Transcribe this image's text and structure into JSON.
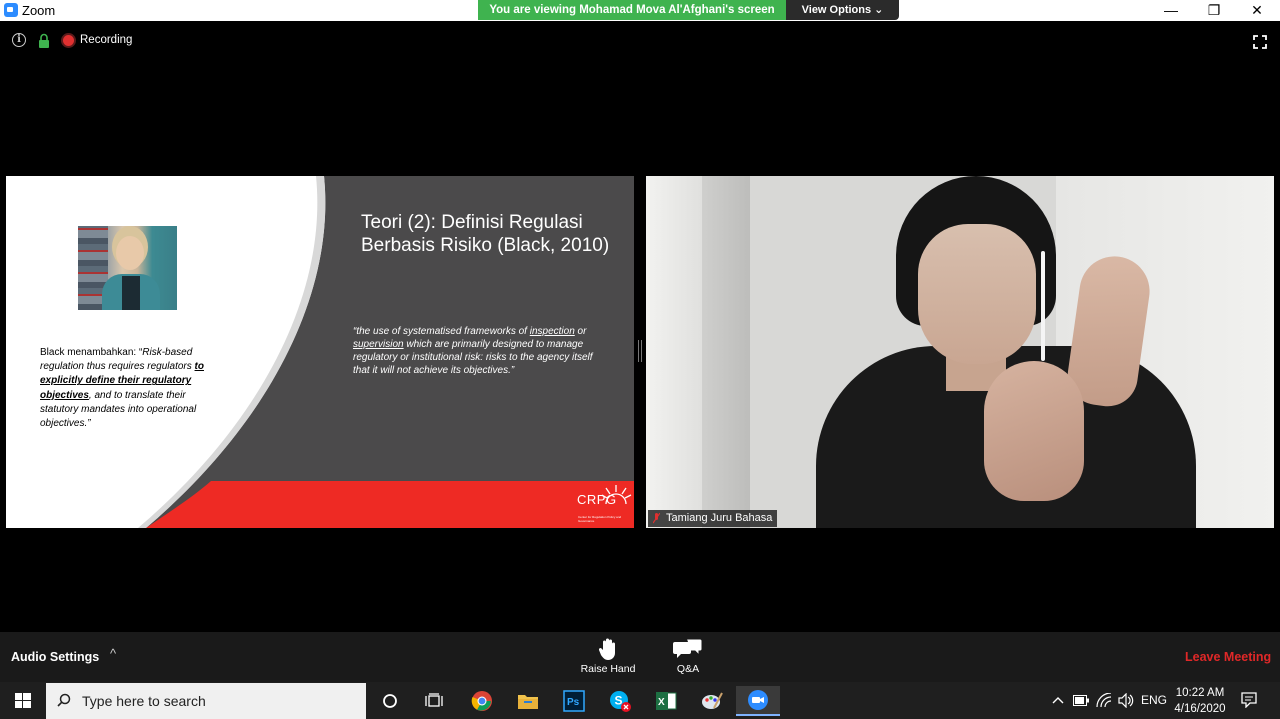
{
  "window": {
    "app_title": "Zoom",
    "viewing_banner": "You are viewing Mohamad Mova Al'Afghani's screen",
    "view_options": "View Options ⌄",
    "minimize": "—",
    "restore": "❐",
    "close": "✕"
  },
  "meeting": {
    "recording_label": "Recording",
    "colors": {
      "recording": "#e03030",
      "banner": "#3FB34F",
      "leave": "#e02828"
    }
  },
  "slide": {
    "title": "Teori (2): Definisi Regulasi Berbasis Risiko (Black, 2010)",
    "left_text_intro": "Black menambahkan: “",
    "left_text_italic1": "Risk-based regulation thus requires regulators ",
    "left_text_emph": "to explicitly define their regulatory objectives",
    "left_text_italic2": ", and to translate their statutory mandates into operational objectives.”",
    "quote_part1": "“the use of systematised frameworks of ",
    "quote_link1": "inspection",
    "quote_part2": " or ",
    "quote_link2": "supervision",
    "quote_part3": " which are primarily designed to manage regulatory or institutional risk: risks to the agency itself that it will not achieve its objectives.”",
    "logo_text": "CRPG",
    "logo_subtext": "Center for Regulation Policy and Governance"
  },
  "video": {
    "participant_name": "Tamiang Juru Bahasa"
  },
  "controls": {
    "audio_settings": "Audio Settings",
    "caret": "^",
    "raise_hand": "Raise Hand",
    "qa": "Q&A",
    "leave_meeting": "Leave Meeting"
  },
  "taskbar": {
    "search_placeholder": "Type here to search",
    "language": "ENG",
    "time": "10:22 AM",
    "date": "4/16/2020",
    "icons": [
      "cortana-icon",
      "task-view-icon",
      "chrome-icon",
      "file-explorer-icon",
      "photoshop-icon",
      "skype-icon",
      "excel-icon",
      "paint-icon",
      "zoom-icon"
    ]
  }
}
